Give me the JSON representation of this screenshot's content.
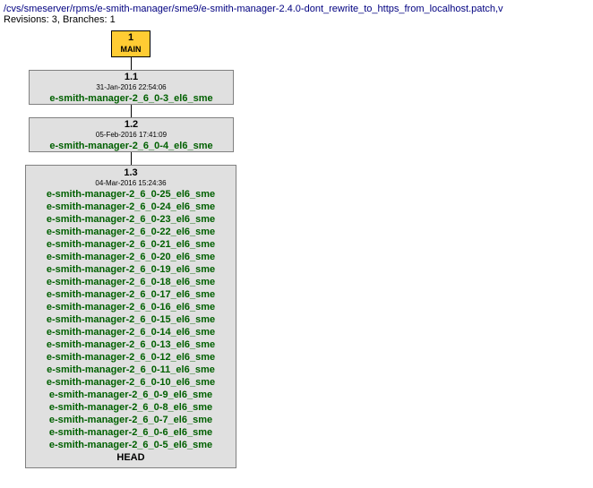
{
  "header": {
    "path": "/cvs/smeserver/rpms/e-smith-manager/sme9/e-smith-manager-2.4.0-dont_rewrite_to_https_from_localhost.patch,v",
    "info": "Revisions: 3, Branches: 1"
  },
  "nodes": {
    "main": {
      "rev": "1",
      "label": "MAIN"
    },
    "r11": {
      "rev": "1.1",
      "date": "31-Jan-2016 22:54:06",
      "tags": [
        "e-smith-manager-2_6_0-3_el6_sme"
      ]
    },
    "r12": {
      "rev": "1.2",
      "date": "05-Feb-2016 17:41:09",
      "tags": [
        "e-smith-manager-2_6_0-4_el6_sme"
      ]
    },
    "r13": {
      "rev": "1.3",
      "date": "04-Mar-2016 15:24:36",
      "tags": [
        "e-smith-manager-2_6_0-25_el6_sme",
        "e-smith-manager-2_6_0-24_el6_sme",
        "e-smith-manager-2_6_0-23_el6_sme",
        "e-smith-manager-2_6_0-22_el6_sme",
        "e-smith-manager-2_6_0-21_el6_sme",
        "e-smith-manager-2_6_0-20_el6_sme",
        "e-smith-manager-2_6_0-19_el6_sme",
        "e-smith-manager-2_6_0-18_el6_sme",
        "e-smith-manager-2_6_0-17_el6_sme",
        "e-smith-manager-2_6_0-16_el6_sme",
        "e-smith-manager-2_6_0-15_el6_sme",
        "e-smith-manager-2_6_0-14_el6_sme",
        "e-smith-manager-2_6_0-13_el6_sme",
        "e-smith-manager-2_6_0-12_el6_sme",
        "e-smith-manager-2_6_0-11_el6_sme",
        "e-smith-manager-2_6_0-10_el6_sme",
        "e-smith-manager-2_6_0-9_el6_sme",
        "e-smith-manager-2_6_0-8_el6_sme",
        "e-smith-manager-2_6_0-7_el6_sme",
        "e-smith-manager-2_6_0-6_el6_sme",
        "e-smith-manager-2_6_0-5_el6_sme"
      ],
      "head": "HEAD"
    }
  }
}
